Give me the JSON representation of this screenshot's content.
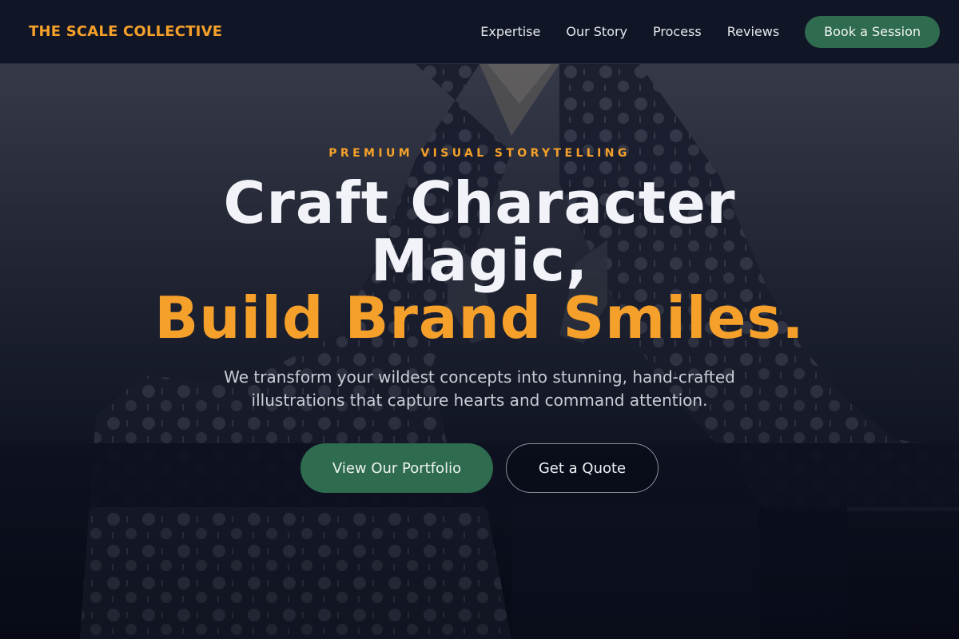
{
  "nav": {
    "brand": "THE SCALE COLLECTIVE",
    "links": [
      "Expertise",
      "Our Story",
      "Process",
      "Reviews"
    ],
    "cta_label": "Book a Session"
  },
  "hero": {
    "eyebrow": "PREMIUM VISUAL STORYTELLING",
    "headline_line1": "Craft Character",
    "headline_line2": "Magic,",
    "headline_line3": "Build Brand Smiles.",
    "subtitle_line1": "We transform your wildest concepts into stunning, hand-crafted",
    "subtitle_line2": "illustrations that capture hearts and command attention.",
    "primary_cta": "View Our Portfolio",
    "secondary_cta": "Get a Quote"
  },
  "colors": {
    "accent": "#f5a02a",
    "brand_green": "#2e6b4f",
    "nav_bg": "#111626",
    "page_bg": "#0b0f1c"
  },
  "background": {
    "image": "dark-illustration-figure-in-polka-dot-robe"
  }
}
